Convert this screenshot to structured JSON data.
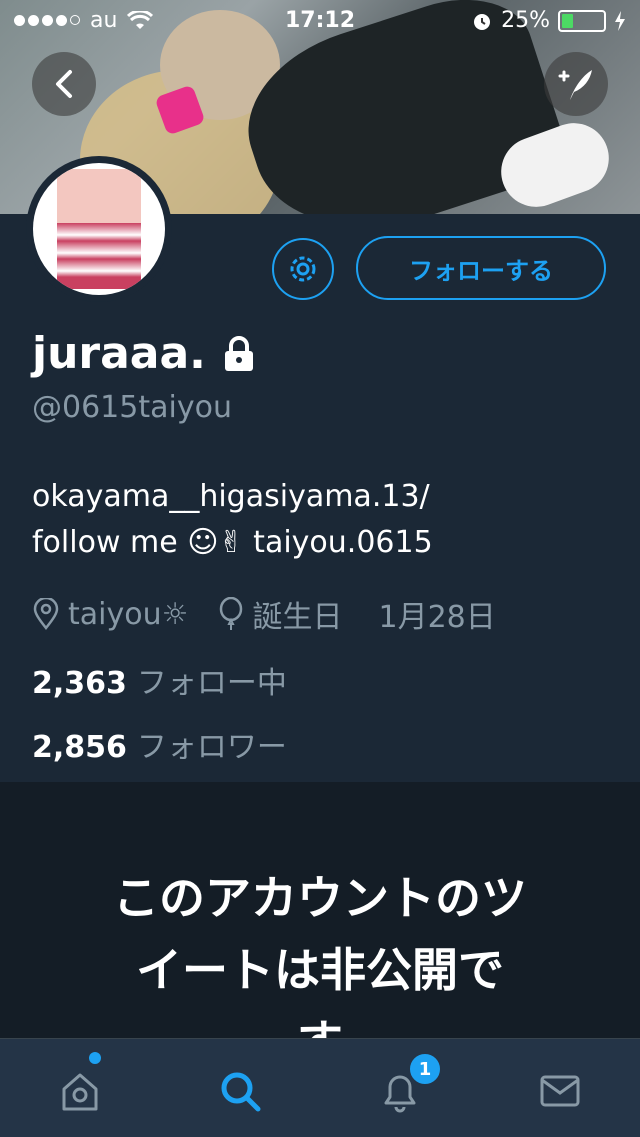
{
  "status_bar": {
    "carrier": "au",
    "time": "17:12",
    "battery": "25%"
  },
  "profile": {
    "display_name": "juraaa.",
    "handle": "@0615taiyou",
    "bio_line1": "okayama__higasiyama.13/",
    "bio_line2": "follow me ☺✌ taiyou.0615",
    "location": "taiyou☼",
    "birthday_label": "誕生日",
    "birthday_value": "1月28日",
    "following_count": "2,363",
    "following_label": "フォロー中",
    "followers_count": "2,856",
    "followers_label": "フォロワー"
  },
  "actions": {
    "follow_label": "フォローする"
  },
  "private_notice": {
    "line1": "このアカウントのツ",
    "line2": "イートは非公開で",
    "line3": "す"
  },
  "tabbar": {
    "notification_badge": "1"
  },
  "colors": {
    "accent": "#1da1f2",
    "header_bg": "#1b2836",
    "page_bg": "#141d26",
    "tabbar_bg": "#243447",
    "muted_text": "#8899a6"
  }
}
